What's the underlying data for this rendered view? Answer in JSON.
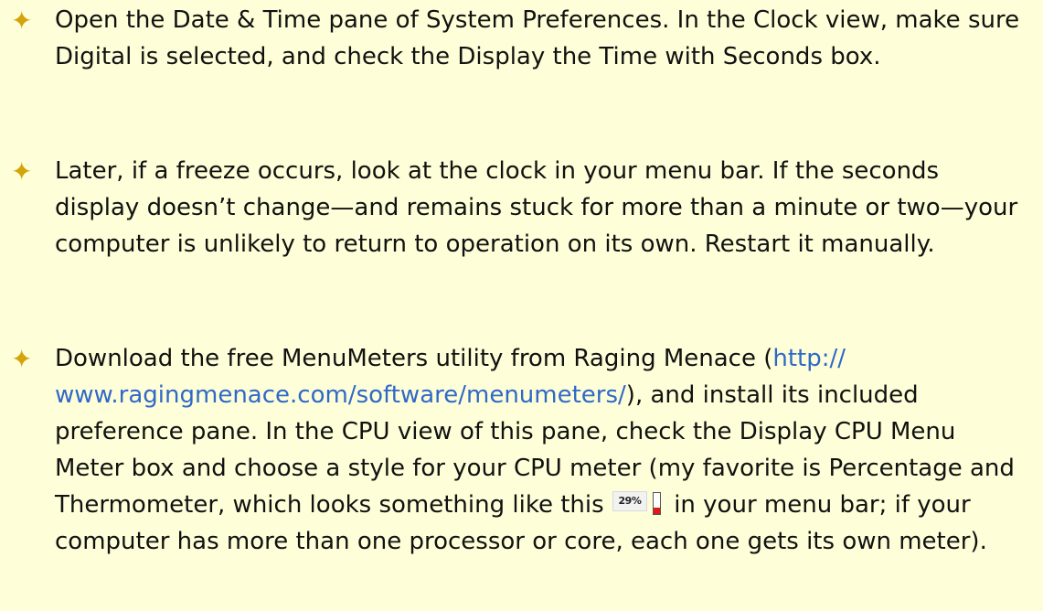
{
  "bullets": [
    {
      "text": "Open the Date & Time pane of System Preferences. In the Clock view, make sure Digital is selected, and check the Display the Time with Seconds box."
    },
    {
      "text": "Later, if a freeze occurs, look at the clock in your menu bar. If the seconds display doesn’t change—and remains stuck for more than a minute or two—your computer is unlikely to return to operation on its own. Restart it manually."
    },
    {
      "text_before": "Download the free MenuMeters utility from Raging Menace (",
      "link": "http://www.ragingmenace.com/software/menumeters/",
      "text_middle": "), and install its included preference pane. In the CPU view of this pane, check the Display CPU Menu Meter box and choose a style for your CPU meter (my favorite is Percentage and Thermometer, which looks something like this ",
      "text_after": " in your menu bar; if your computer has more than one processor or core, each one gets its own meter)."
    }
  ],
  "cpu_meter": {
    "percent_label": "29%",
    "percent_value": 0.29,
    "fill_color": "#e01818",
    "accent_color": "#2a5fd0"
  },
  "colors": {
    "background": "#fefed8",
    "bullet_star": "#d4a40c",
    "link": "#2f69c8",
    "text": "#111111"
  },
  "icons": {
    "bullet": "four-pointed-star-icon"
  }
}
